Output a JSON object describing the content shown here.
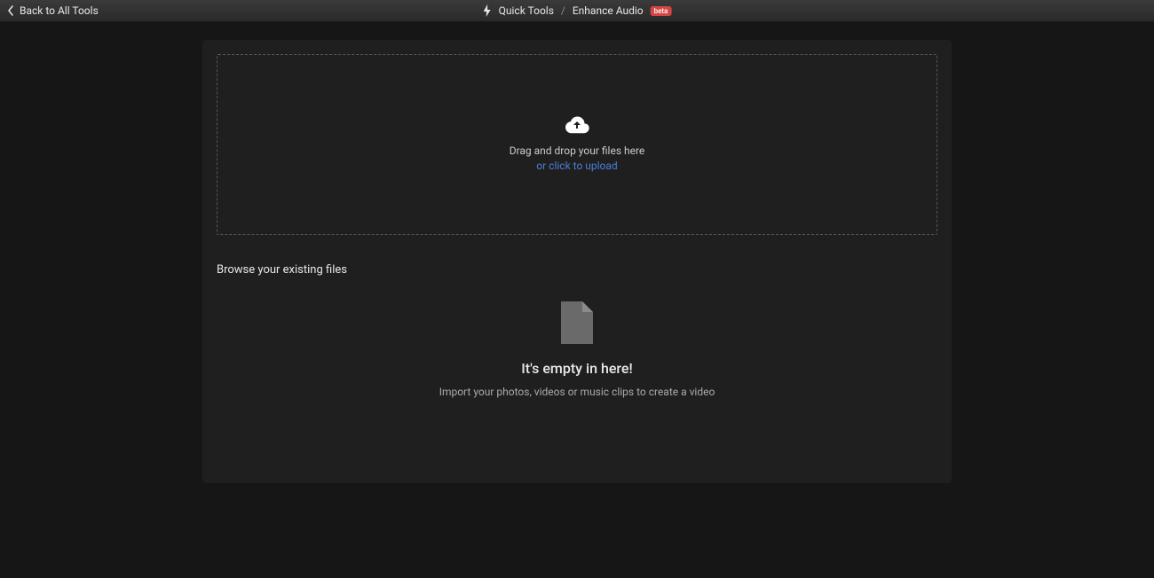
{
  "header": {
    "back_label": "Back to All Tools",
    "breadcrumb_root": "Quick Tools",
    "breadcrumb_current": "Enhance Audio",
    "badge": "beta"
  },
  "dropzone": {
    "text": "Drag and drop your files here",
    "link": "or click to upload"
  },
  "browse": {
    "title": "Browse your existing files",
    "empty_title": "It's empty in here!",
    "empty_desc": "Import your photos, videos or music clips to create a video"
  }
}
